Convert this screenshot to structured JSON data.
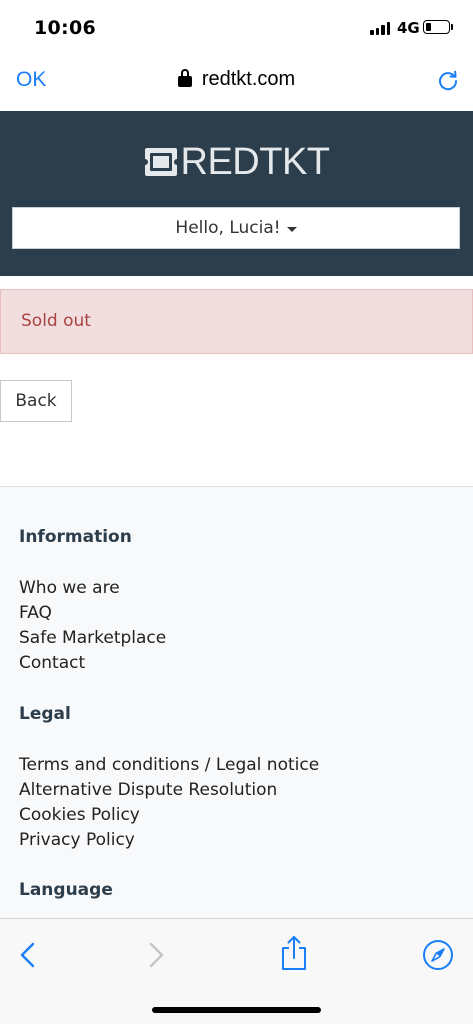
{
  "status_bar": {
    "time": "10:06",
    "network": "4G",
    "signal_bars": 4,
    "battery_level": 0.25
  },
  "browser": {
    "done_label": "OK",
    "url": "redtkt.com",
    "lock_icon": "lock-icon",
    "reload_icon": "reload-icon"
  },
  "header": {
    "logo_text": "REDTKT",
    "user_menu_label": "Hello, Lucia!",
    "background_color": "#2c3e4c"
  },
  "alert": {
    "message": "Sold out",
    "text_color": "#a94442",
    "background_color": "#f2dede"
  },
  "back_button": {
    "label": "Back"
  },
  "footer": {
    "information": {
      "heading": "Information",
      "links": [
        "Who we are",
        "FAQ",
        "Safe Marketplace",
        "Contact"
      ]
    },
    "legal": {
      "heading": "Legal",
      "links": [
        "Terms and conditions / Legal notice",
        "Alternative Dispute Resolution",
        "Cookies Policy",
        "Privacy Policy"
      ]
    },
    "language": {
      "heading": "Language"
    }
  },
  "toolbar": {
    "icons": [
      "back-icon",
      "forward-icon",
      "share-icon",
      "compass-icon"
    ],
    "accent_color": "#1a7ff7"
  }
}
